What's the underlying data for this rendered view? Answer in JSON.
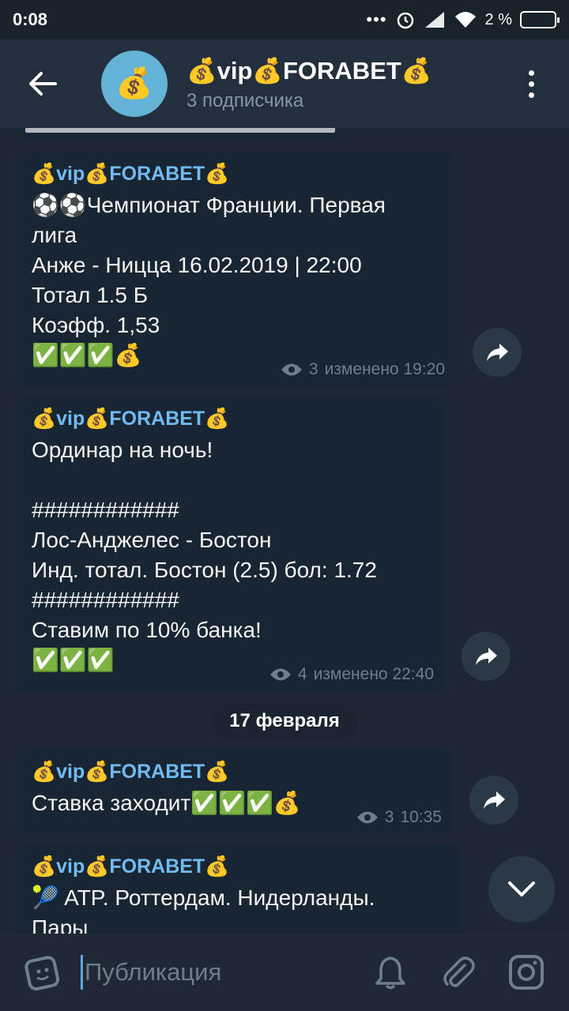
{
  "status": {
    "time": "0:08",
    "dots": "•••",
    "battery_text": "2 %"
  },
  "header": {
    "title": "💰vip💰FORABET💰",
    "subtitle": "3 подписчика",
    "avatar_emoji": "💰"
  },
  "messages": [
    {
      "sender": "💰vip💰FORABET💰",
      "text": "⚽⚽Чемпионат Франции. Первая\nлига\nАнже - Ницца 16.02.2019 | 22:00\nТотал 1.5 Б\nКоэфф. 1,53\n✅✅✅💰",
      "views": "3",
      "time": "изменено 19:20"
    },
    {
      "sender": "💰vip💰FORABET💰",
      "text": "Ординар на ночь!\n\n############\nЛос-Анджелес - Бостон\nИнд. тотал. Бостон (2.5) бол: 1.72\n############\nСтавим по 10% банка!\n✅✅✅",
      "views": "4",
      "time": "изменено 22:40"
    },
    {
      "sender": "💰vip💰FORABET💰",
      "text": "Ставка заходит✅✅✅💰",
      "views": "3",
      "time": "10:35"
    },
    {
      "sender": "💰vip💰FORABET💰",
      "text": "🎾 ATP. Роттердам. Нидерланды.\nПары"
    }
  ],
  "date_separator": "17 февраля",
  "composer": {
    "placeholder": "Публикация"
  },
  "colors": {
    "background": "#1d2733",
    "header": "#242f3d",
    "bubble": "#182533",
    "accent": "#71baf2"
  }
}
